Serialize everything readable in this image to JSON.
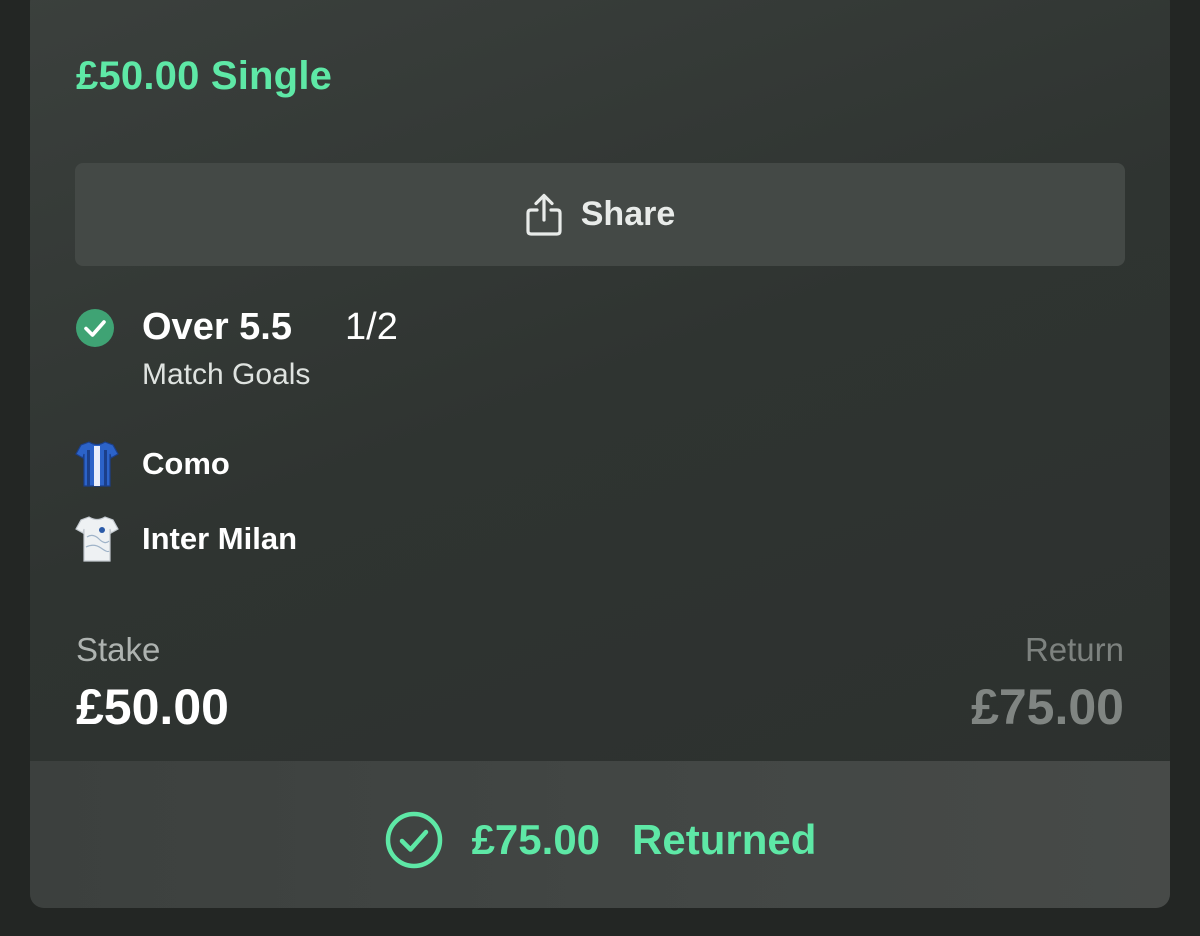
{
  "bet": {
    "title": "£50.00 Single",
    "share_label": "Share",
    "selection": {
      "name": "Over 5.5",
      "odds": "1/2",
      "market": "Match Goals",
      "status_icon": "check-circle-icon"
    },
    "teams": [
      {
        "name": "Como",
        "icon": "como-shirt-icon"
      },
      {
        "name": "Inter Milan",
        "icon": "inter-milan-shirt-icon"
      }
    ],
    "stake_label": "Stake",
    "stake_value": "£50.00",
    "return_label": "Return",
    "return_value": "£75.00",
    "result": {
      "amount": "£75.00",
      "text": "Returned",
      "icon": "check-circle-outline-icon"
    }
  },
  "colors": {
    "accent_green": "#5ee8a6",
    "card_background": "#2f3431",
    "page_background": "#232624"
  }
}
